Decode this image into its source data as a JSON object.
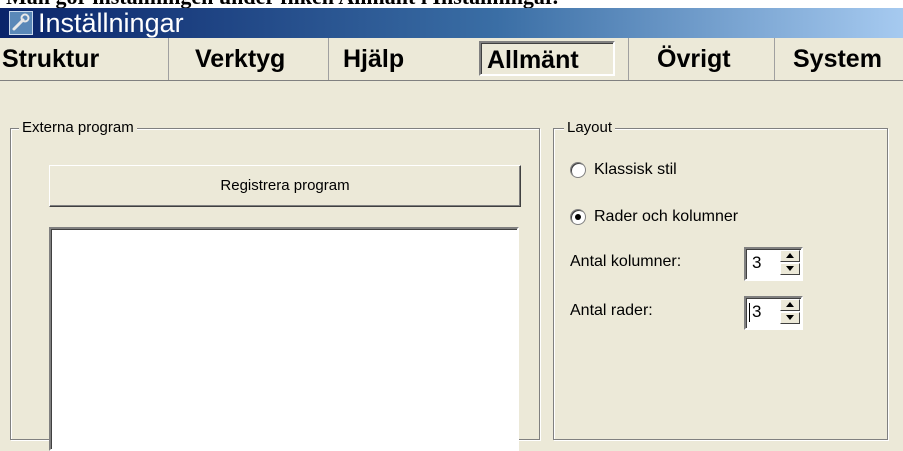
{
  "caption": "Man gör inställningen under fliken Allmänt i Inställningar.",
  "window": {
    "title": "Inställningar",
    "icon": "wrench-icon"
  },
  "tabs": [
    {
      "label": "Struktur"
    },
    {
      "label": "Verktyg"
    },
    {
      "label": "Hjälp"
    },
    {
      "label": "Allmänt",
      "active": true
    },
    {
      "label": "Övrigt"
    },
    {
      "label": "System"
    }
  ],
  "external_programs": {
    "legend": "Externa program",
    "register_button": "Registrera program"
  },
  "layout": {
    "legend": "Layout",
    "options": [
      {
        "label": "Klassisk stil",
        "selected": false
      },
      {
        "label": "Rader och kolumner",
        "selected": true
      }
    ],
    "columns_label": "Antal kolumner:",
    "columns_value": "3",
    "rows_label": "Antal rader:",
    "rows_value": "3"
  }
}
